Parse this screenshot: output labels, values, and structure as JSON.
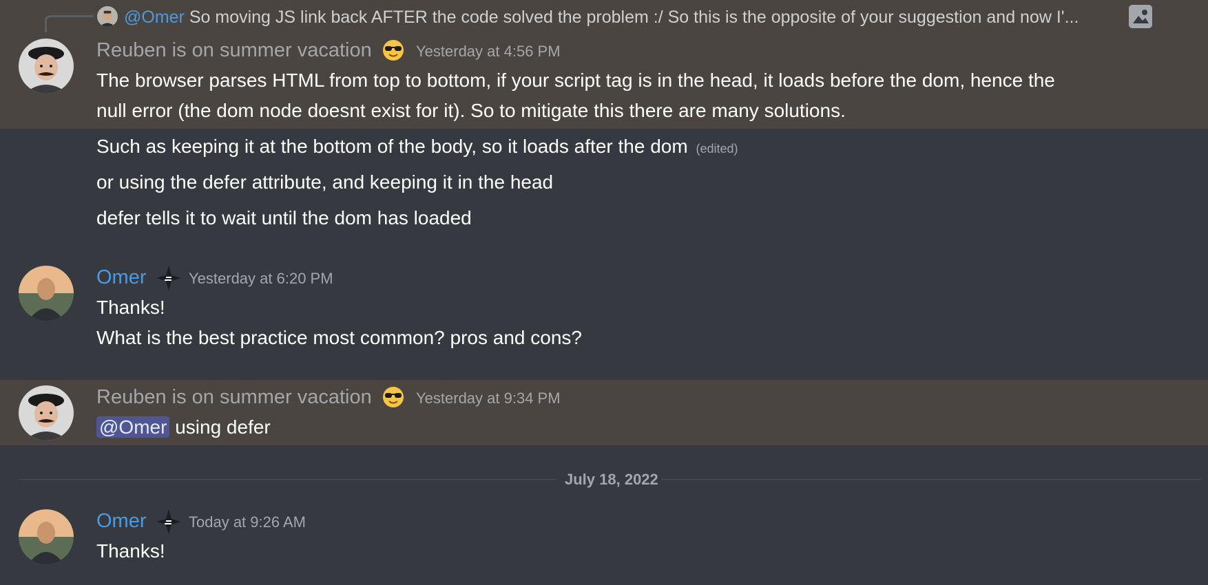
{
  "reply": {
    "mention": "@Omer",
    "text": "So moving JS link back AFTER the code solved the problem :/  So this is the opposite of your suggestion and now I'..."
  },
  "messages": [
    {
      "author": "Reuben is on summer vacation",
      "timestamp": "Yesterday at 4:56 PM",
      "lines": [
        "The browser parses HTML from top to bottom, if your script tag is in the head, it loads before the dom, hence the",
        "null error (the dom node doesnt exist for it). So to mitigate this there are many solutions."
      ]
    },
    {
      "line": "Such as keeping it at the bottom of the body, so it loads after the dom",
      "edited": "(edited)"
    },
    {
      "line": "or using the defer attribute, and keeping it in the head"
    },
    {
      "line": "defer tells it to wait until the dom has loaded"
    },
    {
      "author": "Omer",
      "timestamp": "Yesterday at 6:20 PM",
      "lines": [
        "Thanks!",
        "What is the best practice most common? pros and cons?"
      ]
    },
    {
      "author": "Reuben is on summer vacation",
      "timestamp": "Yesterday at 9:34 PM",
      "mention": "@Omer",
      "text": "using defer"
    },
    {
      "author": "Omer",
      "timestamp": "Today at 9:26 AM",
      "lines": [
        "Thanks!"
      ]
    }
  ],
  "date_divider": "July 18, 2022",
  "colors": {
    "background": "#36393f",
    "highlight": "#4a4541",
    "omer_name": "#4c9be0",
    "reuben_name": "#a3a6aa",
    "mention_bg": "#4f5693"
  },
  "icons": [
    "image-icon",
    "sunglasses-emoji",
    "star-badge-icon"
  ]
}
